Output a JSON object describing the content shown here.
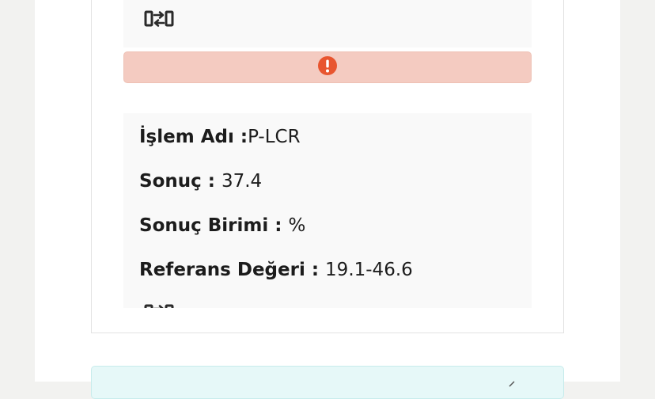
{
  "result": {
    "alert_icon": "exclamation-circle-icon",
    "alert_color": "#e8552f",
    "alert_bg": "#f4cbc1",
    "swap_icon": "swap-arrows-icon",
    "details": [
      {
        "label": "İşlem Adı :",
        "value": "P-LCR"
      },
      {
        "label": "Sonuç : ",
        "value": "37.4"
      },
      {
        "label": "Sonuç Birimi : ",
        "value": "%"
      },
      {
        "label": "Referans Değeri : ",
        "value": "19.1-46.6"
      }
    ]
  },
  "info_card": {
    "icon": "chevron-icon",
    "bg": "#e6f8f8"
  }
}
